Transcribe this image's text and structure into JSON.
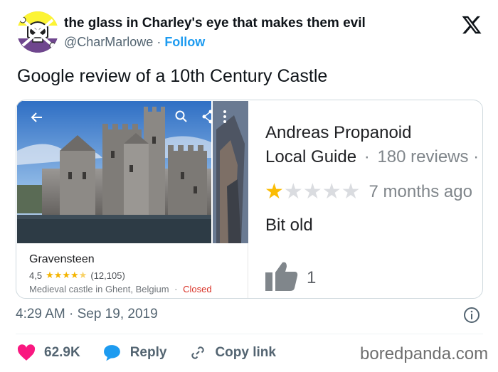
{
  "header": {
    "display_name": "the glass in Charley's eye that makes them evil",
    "handle": "@CharMarlowe",
    "separator": "·",
    "follow_label": "Follow"
  },
  "tweet": {
    "text": "Google review of a 10th Century Castle",
    "timestamp": "4:29 AM · Sep 19, 2019"
  },
  "review_card": {
    "place": {
      "name": "Gravensteen",
      "rating": "4,5",
      "rating_value": 4.5,
      "review_count": "(12,105)",
      "description": "Medieval castle in Ghent, Belgium",
      "separator": "·",
      "status": "Closed"
    },
    "reviewer": {
      "name": "Andreas Propanoid",
      "badge": "Local Guide",
      "separator": "·",
      "reviews": "180 reviews ·",
      "stars_given": 1,
      "stars_max": 5,
      "time_ago": "7 months ago",
      "review_text": "Bit old",
      "likes": "1"
    }
  },
  "actions": {
    "likes": "62.9K",
    "reply_label": "Reply",
    "copy_link_label": "Copy link"
  },
  "watermark": "boredpanda.com",
  "colors": {
    "accent_blue": "#1d9bf0",
    "like_pink": "#f91880",
    "star_yellow": "#fbbc04",
    "closed_red": "#d93025",
    "muted_text": "#536471"
  },
  "icons": {
    "x_logo": "x-logo-icon",
    "back": "arrow-left-icon",
    "search": "search-icon",
    "share": "share-icon",
    "more": "more-vertical-icon",
    "thumbs_up": "thumbs-up-icon",
    "info": "info-icon",
    "heart": "heart-icon",
    "reply": "speech-bubble-icon",
    "copy_link": "link-icon"
  }
}
